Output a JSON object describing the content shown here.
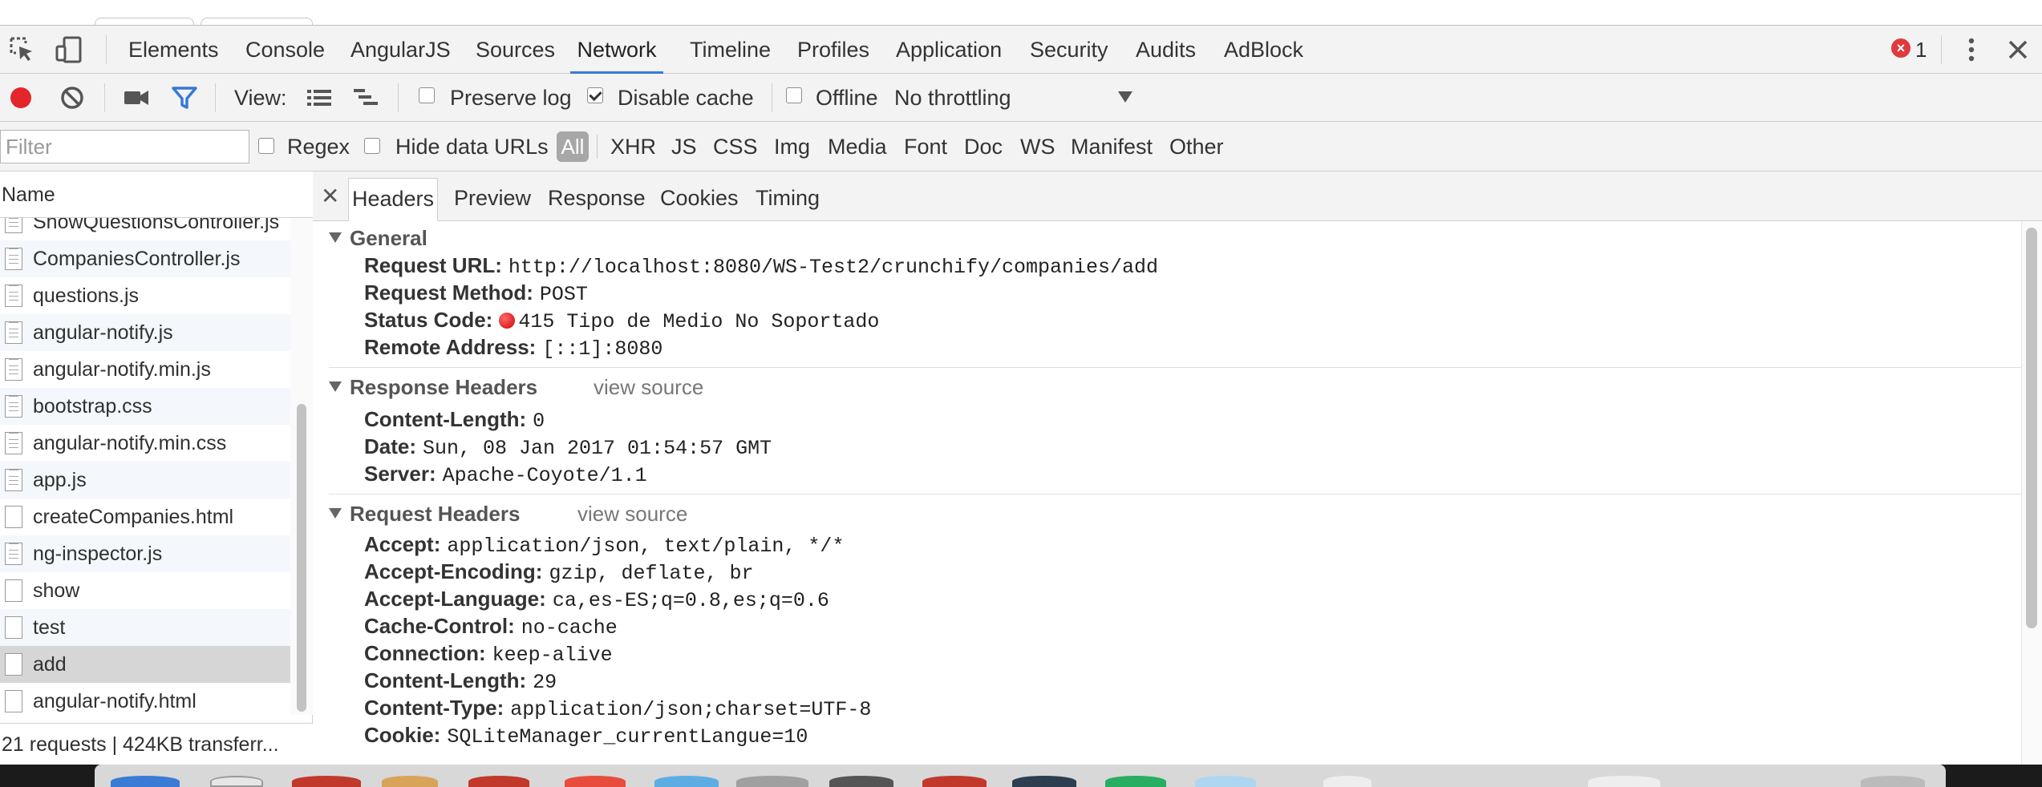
{
  "main_tabs": [
    "Elements",
    "Console",
    "AngularJS",
    "Sources",
    "Network",
    "Timeline",
    "Profiles",
    "Application",
    "Security",
    "Audits",
    "AdBlock"
  ],
  "active_tab": "Network",
  "error_count": "1",
  "toolbar": {
    "view_label": "View:",
    "preserve_log": "Preserve log",
    "disable_cache": "Disable cache",
    "offline": "Offline",
    "throttling": "No throttling"
  },
  "filter": {
    "placeholder": "Filter",
    "regex": "Regex",
    "hide_data_urls": "Hide data URLs",
    "all": "All",
    "types": [
      "XHR",
      "JS",
      "CSS",
      "Img",
      "Media",
      "Font",
      "Doc",
      "WS",
      "Manifest",
      "Other"
    ]
  },
  "requests": {
    "name_header": "Name",
    "items": [
      "ShowQuestionsController.js",
      "CompaniesController.js",
      "questions.js",
      "angular-notify.js",
      "angular-notify.min.js",
      "bootstrap.css",
      "angular-notify.min.css",
      "app.js",
      "createCompanies.html",
      "ng-inspector.js",
      "show",
      "test",
      "add",
      "angular-notify.html"
    ],
    "selected": "add",
    "status": "21 requests | 424KB transferr..."
  },
  "detail_tabs": [
    "Headers",
    "Preview",
    "Response",
    "Cookies",
    "Timing"
  ],
  "general": {
    "title": "General",
    "rows": [
      {
        "key": "Request URL:",
        "value": "http://localhost:8080/WS-Test2/crunchify/companies/add"
      },
      {
        "key": "Request Method:",
        "value": "POST"
      },
      {
        "key": "Status Code:",
        "value": "415 Tipo de Medio No Soportado"
      },
      {
        "key": "Remote Address:",
        "value": "[::1]:8080"
      }
    ]
  },
  "response_headers": {
    "title": "Response Headers",
    "view_source": "view source",
    "rows": [
      {
        "key": "Content-Length:",
        "value": "0"
      },
      {
        "key": "Date:",
        "value": "Sun, 08 Jan 2017 01:54:57 GMT"
      },
      {
        "key": "Server:",
        "value": "Apache-Coyote/1.1"
      }
    ]
  },
  "request_headers": {
    "title": "Request Headers",
    "view_source": "view source",
    "rows": [
      {
        "key": "Accept:",
        "value": "application/json, text/plain, */*"
      },
      {
        "key": "Accept-Encoding:",
        "value": "gzip, deflate, br"
      },
      {
        "key": "Accept-Language:",
        "value": "ca,es-ES;q=0.8,es;q=0.6"
      },
      {
        "key": "Cache-Control:",
        "value": "no-cache"
      },
      {
        "key": "Connection:",
        "value": "keep-alive"
      },
      {
        "key": "Content-Length:",
        "value": "29"
      },
      {
        "key": "Content-Type:",
        "value": "application/json;charset=UTF-8"
      },
      {
        "key": "Cookie:",
        "value": "SQLiteManager_currentLangue=10"
      }
    ]
  },
  "colors": {
    "accent": "#3879d9",
    "record": "#e2262b",
    "filter_icon": "#3879d9",
    "selected_row": "#d6d6d6"
  },
  "icons": [
    "inspect-icon",
    "device-icon",
    "record-icon",
    "clear-icon",
    "camera-icon",
    "filter-icon",
    "list-view-icon",
    "waterfall-view-icon",
    "error-icon",
    "more-icon",
    "close-icon",
    "file-icon"
  ]
}
